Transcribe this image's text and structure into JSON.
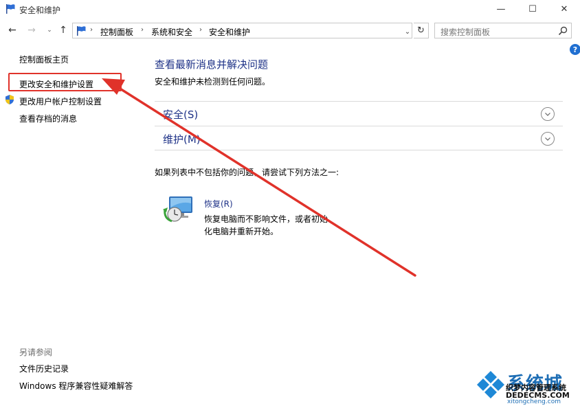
{
  "window": {
    "title": "安全和维护",
    "minimize": "—",
    "maximize": "☐",
    "close": "✕"
  },
  "nav": {
    "back": "←",
    "forward": "→",
    "recent": "⌄",
    "up": "↑",
    "breadcrumb": [
      "控制面板",
      "系统和安全",
      "安全和维护"
    ],
    "separator": "›",
    "dropdown": "⌄",
    "refresh": "↻"
  },
  "search": {
    "placeholder": "搜索控制面板"
  },
  "help": "?",
  "left_pane": {
    "home": "控制面板主页",
    "change_security": "更改安全和维护设置",
    "change_uac": "更改用户帐户控制设置",
    "archived": "查看存档的消息",
    "see_also_label": "另请参阅",
    "file_history": "文件历史记录",
    "compat": "Windows 程序兼容性疑难解答"
  },
  "main": {
    "title": "查看最新消息并解决问题",
    "status": "安全和维护未检测到任何问题。",
    "sections": [
      {
        "label": "安全(S)"
      },
      {
        "label": "维护(M)"
      }
    ],
    "hint": "如果列表中不包括你的问题，请尝试下列方法之一:",
    "recovery": {
      "title": "恢复(R)",
      "desc": "恢复电脑而不影响文件，或者初始化电脑并重新开始。"
    }
  },
  "watermark": {
    "big": "系统城",
    "cn": "织梦内容管理系统",
    "en": "DEDECMS.COM",
    "domain": "xitongcheng.com"
  },
  "colors": {
    "link": "#1e3287",
    "annotation": "#e0322a",
    "accent": "#1f6fd1"
  }
}
